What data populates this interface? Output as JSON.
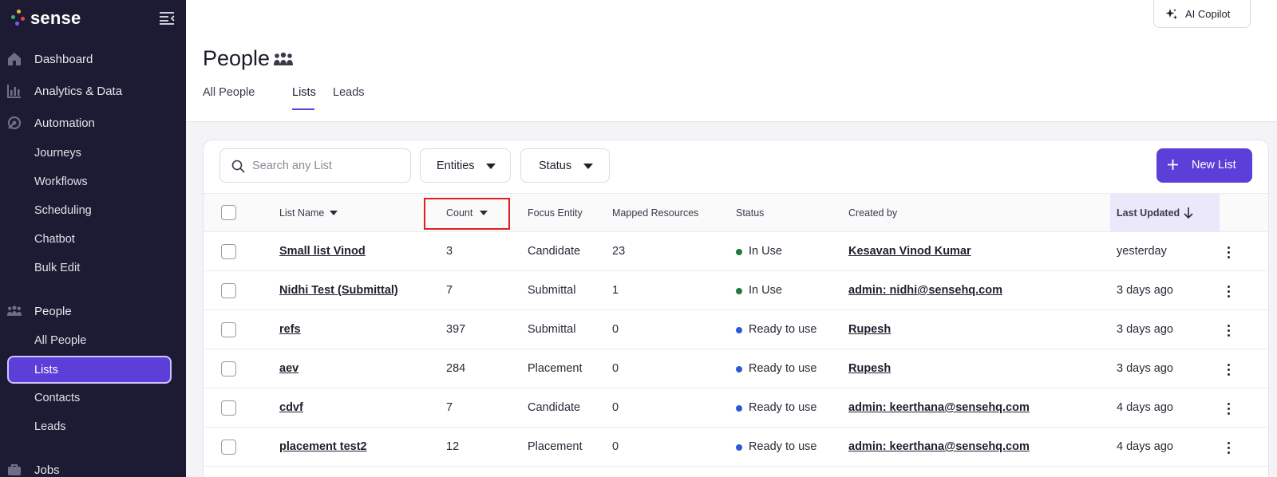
{
  "app": {
    "logo_text": "sense"
  },
  "sidebar": {
    "nav": [
      {
        "label": "Dashboard",
        "icon": "home-icon"
      },
      {
        "label": "Analytics & Data",
        "icon": "bar-chart-icon"
      },
      {
        "label": "Automation",
        "icon": "automation-icon"
      }
    ],
    "automation_items": [
      "Journeys",
      "Workflows",
      "Scheduling",
      "Chatbot",
      "Bulk Edit"
    ],
    "people_section": {
      "label": "People",
      "icon": "people-icon"
    },
    "people_items": [
      "All People",
      "Lists",
      "Contacts",
      "Leads"
    ],
    "active_item": "Lists",
    "jobs_section": {
      "label": "Jobs",
      "icon": "briefcase-icon"
    }
  },
  "header": {
    "copilot_label": "AI Copilot",
    "title": "People",
    "tabs": [
      "All People",
      "Lists",
      "Leads"
    ],
    "active_tab": "Lists"
  },
  "toolbar": {
    "search_placeholder": "Search any List",
    "entities_label": "Entities",
    "status_label": "Status",
    "new_list_label": "New List"
  },
  "table": {
    "columns": [
      "List Name",
      "Count",
      "Focus Entity",
      "Mapped Resources",
      "Status",
      "Created by",
      "Last Updated"
    ],
    "rows": [
      {
        "name": "Small list Vinod",
        "count": "3",
        "entity": "Candidate",
        "mapped": "23",
        "status": "In Use",
        "created_by": "Kesavan Vinod Kumar",
        "updated": "yesterday"
      },
      {
        "name": "Nidhi Test (Submittal)",
        "count": "7",
        "entity": "Submittal",
        "mapped": "1",
        "status": "In Use",
        "created_by": "admin: nidhi@sensehq.com",
        "updated": "3 days ago"
      },
      {
        "name": "refs",
        "count": "397",
        "entity": "Submittal",
        "mapped": "0",
        "status": "Ready to use",
        "created_by": "Rupesh",
        "updated": "3 days ago"
      },
      {
        "name": "aev",
        "count": "284",
        "entity": "Placement",
        "mapped": "0",
        "status": "Ready to use",
        "created_by": "Rupesh",
        "updated": "3 days ago"
      },
      {
        "name": "cdvf",
        "count": "7",
        "entity": "Candidate",
        "mapped": "0",
        "status": "Ready to use",
        "created_by": "admin: keerthana@sensehq.com",
        "updated": "4 days ago"
      },
      {
        "name": "placement test2",
        "count": "12",
        "entity": "Placement",
        "mapped": "0",
        "status": "Ready to use",
        "created_by": "admin: keerthana@sensehq.com",
        "updated": "4 days ago"
      }
    ]
  },
  "colors": {
    "accent": "#5b3fd8",
    "sidebar_bg": "#1c1b33",
    "status_in_use": "#1f7a3a",
    "status_ready": "#2a5bd7",
    "highlight_box": "#e02020"
  }
}
